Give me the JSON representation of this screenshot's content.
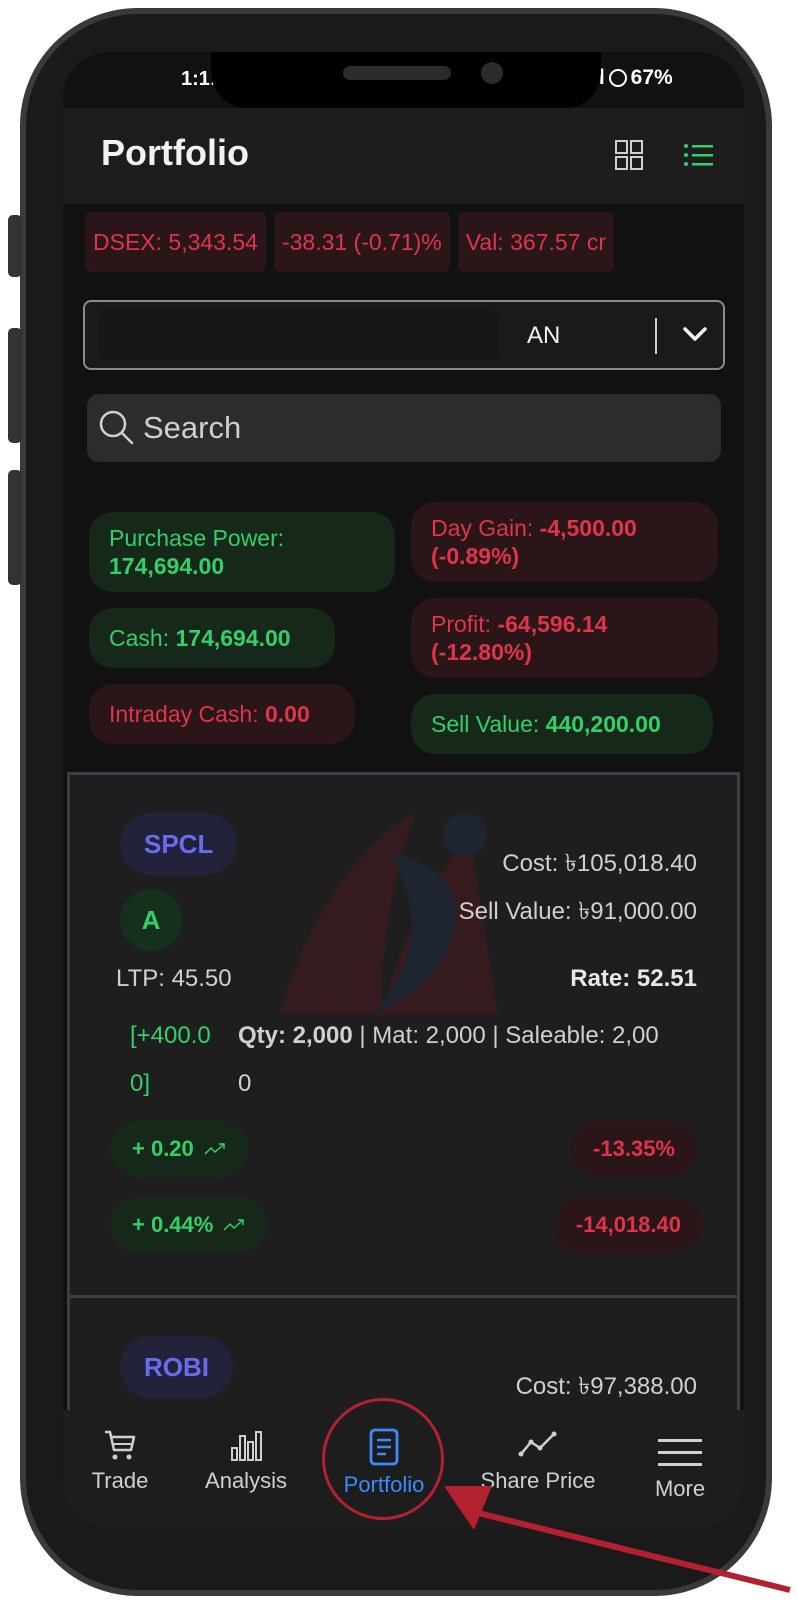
{
  "status_bar": {
    "time": "1:1!",
    "signal": "ıl",
    "battery": "67%"
  },
  "header": {
    "title": "Portfolio"
  },
  "ticker": {
    "index": "DSEX: 5,343.54",
    "change": "-38.31 (-0.71)%",
    "value": "Val: 367.57 cr"
  },
  "account": {
    "visible_suffix": "AN"
  },
  "search": {
    "placeholder": "Search"
  },
  "summary": {
    "purchase_power_label": "Purchase Power:",
    "purchase_power_value": "174,694.00",
    "day_gain_label": "Day Gain:",
    "day_gain_value": "-4,500.00",
    "day_gain_pct": "(-0.89%)",
    "cash_label": "Cash:",
    "cash_value": "174,694.00",
    "profit_label": "Profit:",
    "profit_value": "-64,596.14",
    "profit_pct": "(-12.80%)",
    "intraday_label": "Intraday Cash:",
    "intraday_value": "0.00",
    "sell_value_label": "Sell Value:",
    "sell_value_value": "440,200.00"
  },
  "holdings": [
    {
      "symbol": "SPCL",
      "category": "A",
      "cost": "Cost: ৳105,018.40",
      "sell_value": "Sell Value: ৳91,000.00",
      "ltp": "LTP: 45.50",
      "rate": "Rate: 52.51",
      "gain_line1": "[+400.0",
      "gain_line2": "0]",
      "qty_label": "Qty: 2,000",
      "qty_rest_line1": "| Mat: 2,000 | Saleable: 2,00",
      "qty_rest_line2": "0",
      "change_abs": "+ 0.20",
      "change_pct": "+ 0.44%",
      "loss_pct": "-13.35%",
      "loss_abs": "-14,018.40"
    },
    {
      "symbol": "ROBI",
      "cost": "Cost: ৳97,388.00"
    }
  ],
  "bottom_nav": {
    "items": [
      "Trade",
      "Analysis",
      "Portfolio",
      "Share Price",
      "More"
    ],
    "active": "Portfolio"
  },
  "colors": {
    "gain": "#33d06a",
    "loss": "#e0344a",
    "active": "#3b8bff",
    "annotation": "#b3202f"
  }
}
